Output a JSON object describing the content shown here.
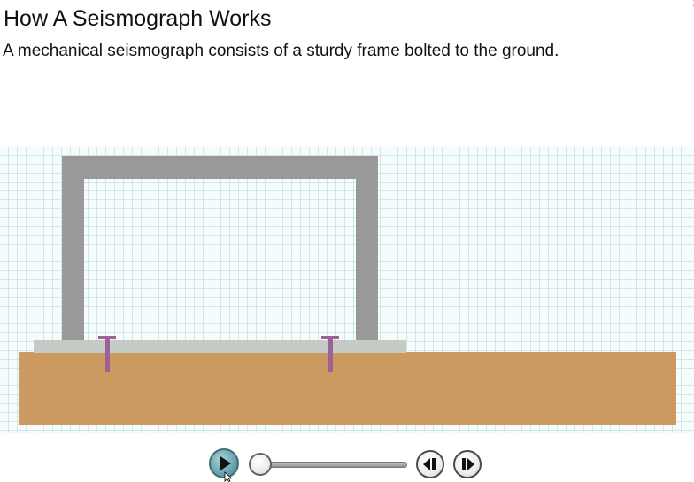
{
  "header": {
    "title": "How A Seismograph Works"
  },
  "narration": {
    "caption": "A mechanical seismograph consists of a sturdy frame bolted to the ground."
  },
  "scene": {
    "colors": {
      "grid_line": "#cfe7e8",
      "grid_background": "#f6fbfb",
      "ground": "#cc9a61",
      "base_plate": "#c5cbc5",
      "frame": "#999999",
      "bolt": "#9b6296"
    }
  },
  "controls": {
    "play_icon": "play-icon",
    "step_back_icon": "step-back-icon",
    "step_forward_icon": "step-forward-icon",
    "progress": 0,
    "accent_color": "#6aa3ad"
  }
}
